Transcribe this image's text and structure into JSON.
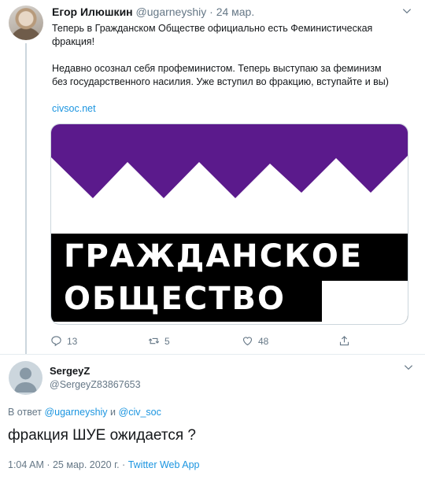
{
  "tweet": {
    "author_name": "Егор Илюшкин",
    "author_handle": "@ugarneyshiy",
    "separator": "·",
    "time": "24 мар.",
    "text_line1": "Теперь в Гражданском Обществе официально есть Феминистическая",
    "text_line2": "фракция!",
    "text_line3": "Недавно осознал себя профеминистом. Теперь выступаю за феминизм",
    "text_line4": "без государственного насилия. Уже вступил во фракцию, вступайте и вы)",
    "link_text": "civsoc.net",
    "card": {
      "line1": "ГРАЖДАНСКОЕ",
      "line2": "ОБЩЕСТВО",
      "accent_color": "#5b1a8c"
    },
    "actions": {
      "reply_count": "13",
      "retweet_count": "5",
      "like_count": "48"
    }
  },
  "reply": {
    "author_name": "SergeyZ",
    "author_handle": "@SergeyZ83867653",
    "reply_prefix": "В ответ",
    "reply_user1": "@ugarneyshiy",
    "reply_and": "и",
    "reply_user2": "@civ_soc",
    "text": "фракция ШУЕ ожидается ?",
    "timestamp": "1:04 AM · 25 мар. 2020 г. ·",
    "client": "Twitter Web App"
  },
  "colors": {
    "link": "#1b95e0",
    "muted": "#657786",
    "border": "#ccd6dd"
  }
}
